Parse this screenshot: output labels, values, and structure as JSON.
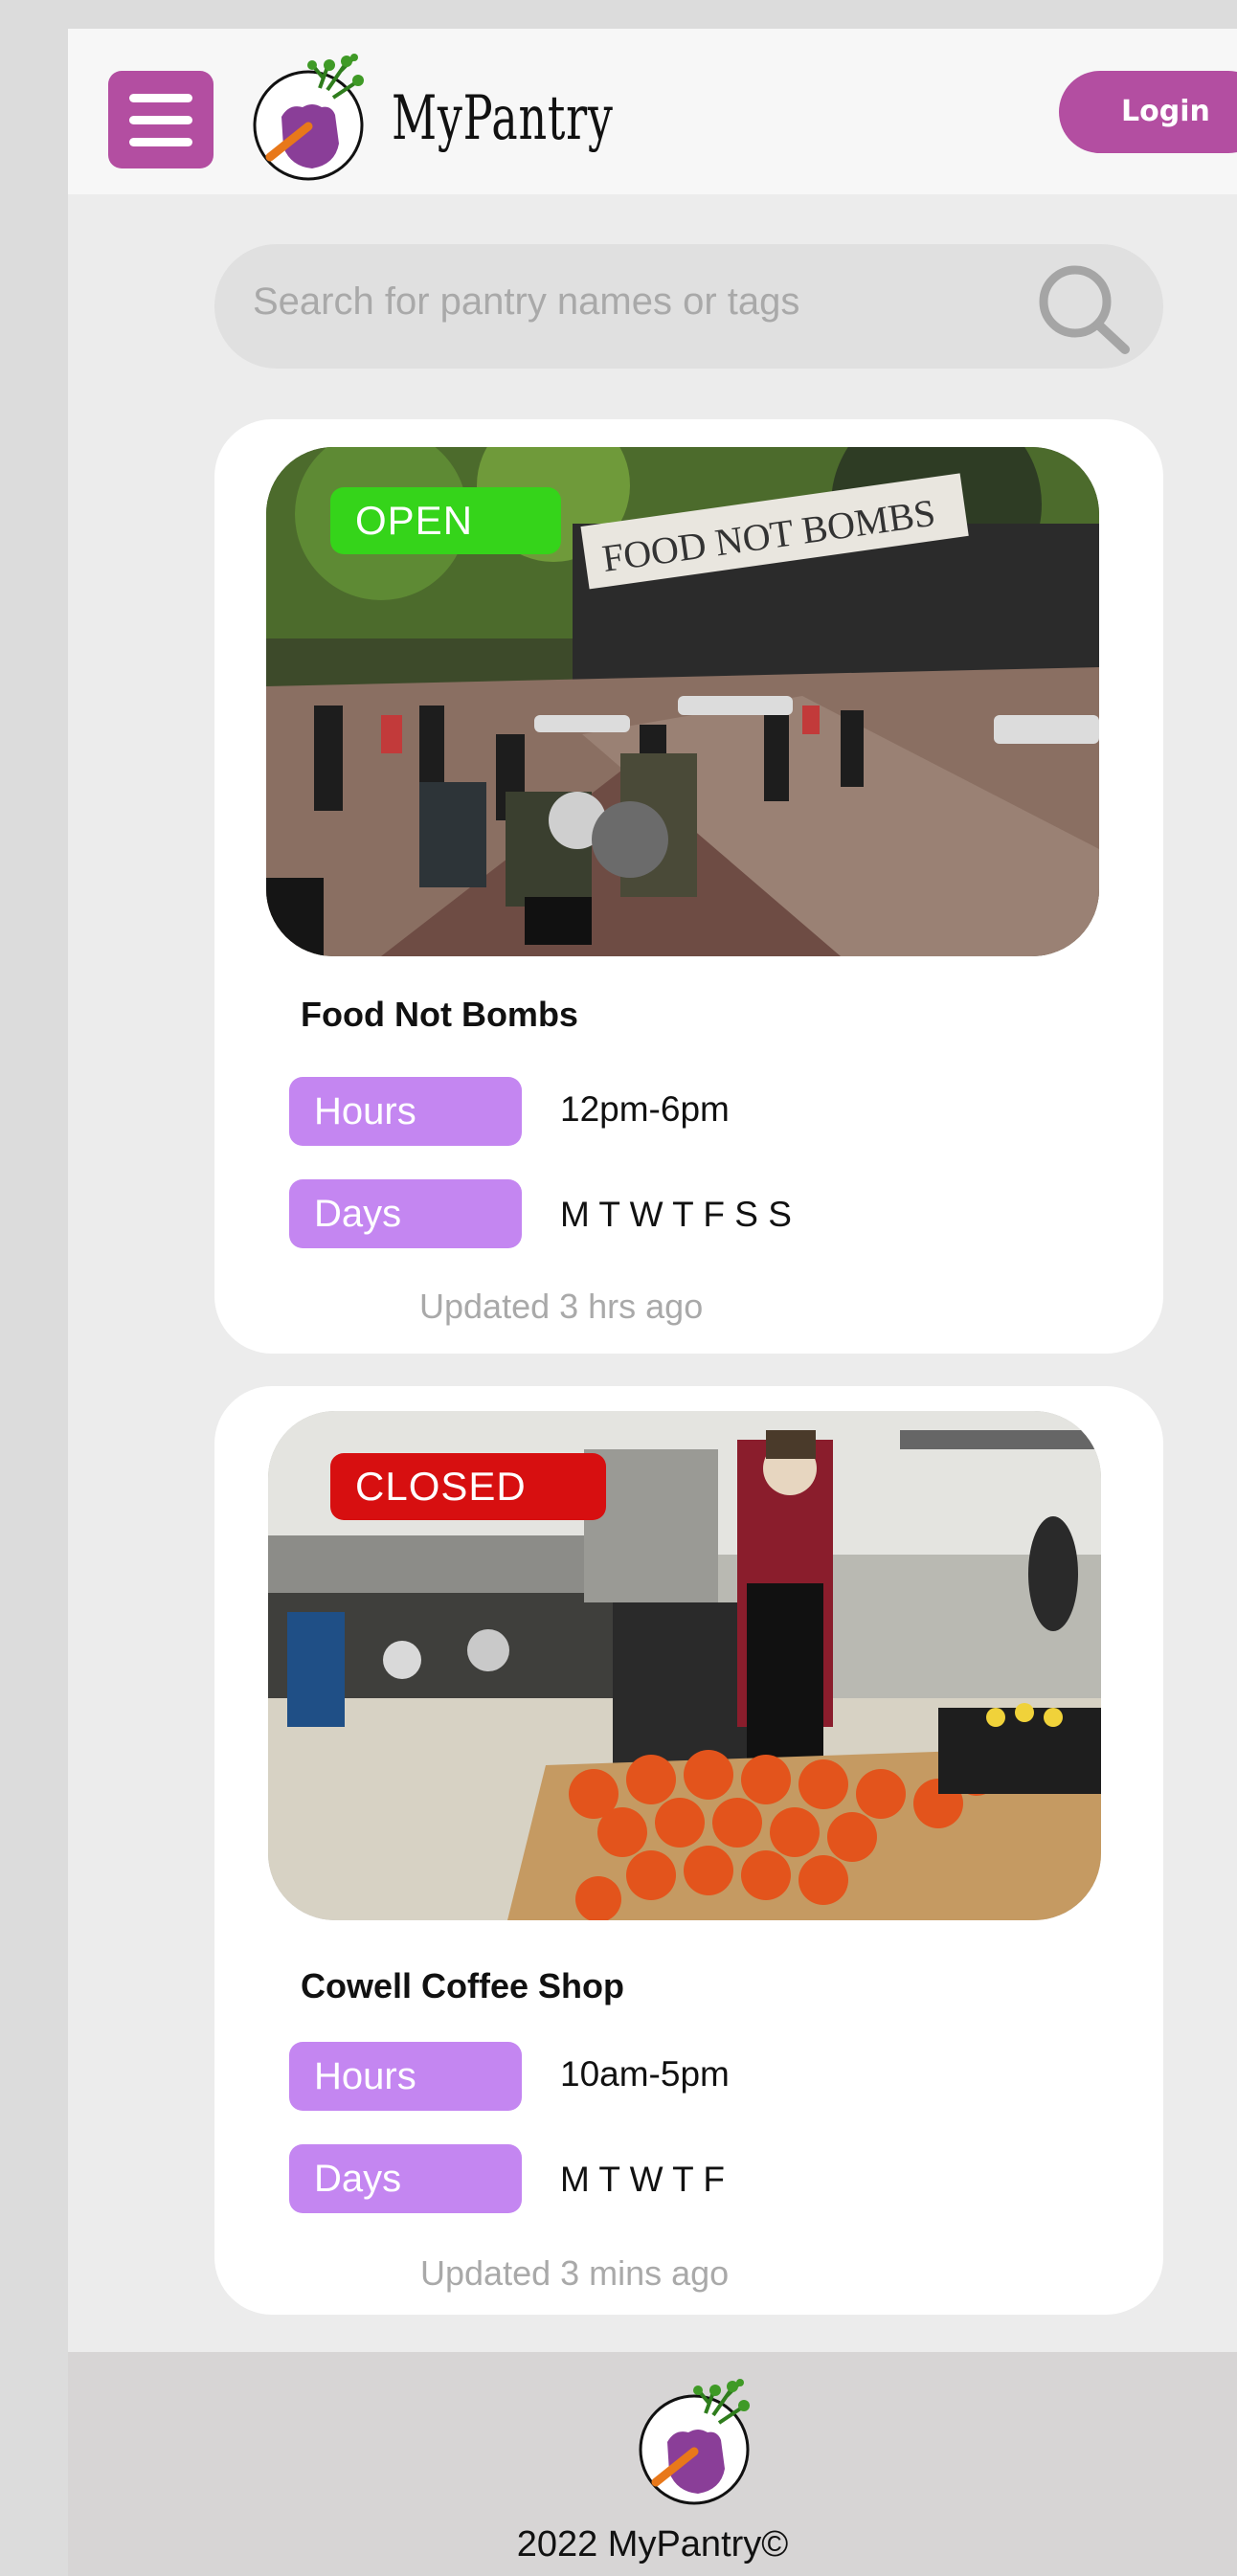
{
  "header": {
    "menu_icon": "hamburger-menu-icon",
    "logo_icon": "fist-with-carrot-logo",
    "brand": "MyPantry",
    "login_label": "Login"
  },
  "search": {
    "placeholder": "Search for pantry names or tags",
    "icon": "search-icon"
  },
  "pantries": [
    {
      "status": "OPEN",
      "status_color": "#35d41a",
      "name": "Food Not Bombs",
      "hours_label": "Hours",
      "hours": "12pm-6pm",
      "days_label": "Days",
      "days": "M T W T F S S",
      "updated": "Updated 3 hrs ago",
      "photo_banner_text": "FOOD NOT BOMBS"
    },
    {
      "status": "CLOSED",
      "status_color": "#d70f10",
      "name": "Cowell Coffee Shop",
      "hours_label": "Hours",
      "hours": "10am-5pm",
      "days_label": "Days",
      "days": "M T W T F",
      "updated": "Updated 3 mins ago"
    }
  ],
  "footer": {
    "logo_icon": "fist-with-carrot-logo",
    "copyright": "2022 MyPantry©"
  },
  "colors": {
    "accent": "#b34ea1",
    "pill": "#c486f1"
  }
}
